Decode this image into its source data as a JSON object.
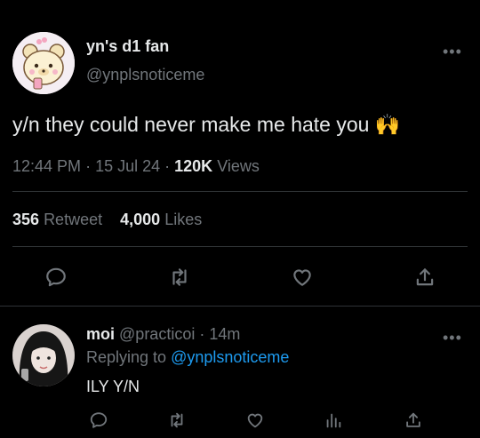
{
  "main_tweet": {
    "display_name": "yn's d1 fan",
    "handle": "@ynplsnoticeme",
    "text": "y/n they could never make me hate you",
    "emoji": "🙌",
    "time": "12:44 PM",
    "date": "15 Jul 24",
    "views_count": "120K",
    "views_label": "Views",
    "retweets_count": "356",
    "retweets_label": "Retweet",
    "likes_count": "4,000",
    "likes_label": "Likes",
    "more_label": "•••"
  },
  "reply": {
    "display_name": "moi",
    "handle": "@practicoi",
    "age": "14m",
    "replying_prefix": "Replying to",
    "replying_handle": "@ynplsnoticeme",
    "text": "ILY Y/N",
    "more_label": "•••"
  },
  "colors": {
    "background": "#000000",
    "text": "#e7e9ea",
    "muted": "#71767b",
    "link": "#1d9bf0",
    "divider": "#2f3336"
  },
  "icons": [
    "reply-icon",
    "retweet-icon",
    "like-icon",
    "share-icon",
    "analytics-icon"
  ]
}
